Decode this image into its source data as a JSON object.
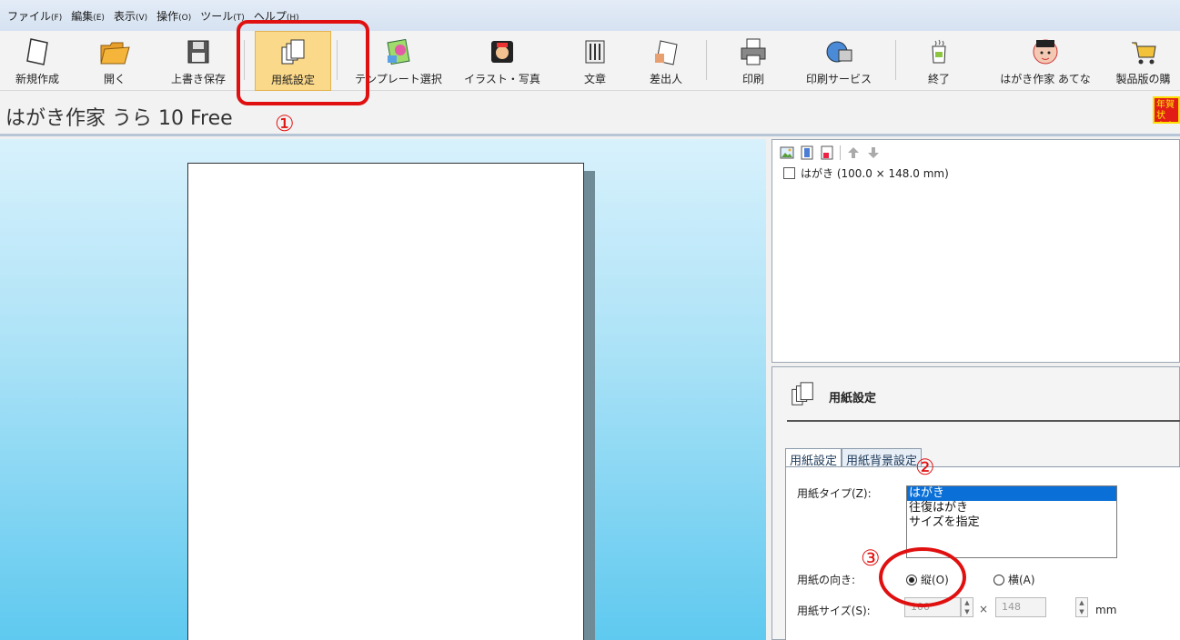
{
  "menu": [
    {
      "label": "ファイル",
      "acc": "(F)"
    },
    {
      "label": "編集",
      "acc": "(E)"
    },
    {
      "label": "表示",
      "acc": "(V)"
    },
    {
      "label": "操作",
      "acc": "(O)"
    },
    {
      "label": "ツール",
      "acc": "(T)"
    },
    {
      "label": "ヘルプ",
      "acc": "(H)"
    }
  ],
  "toolbar": {
    "new": "新規作成",
    "open": "開く",
    "save": "上書き保存",
    "paper": "用紙設定",
    "template": "テンプレート選択",
    "illust": "イラスト・写真",
    "text": "文章",
    "sender": "差出人",
    "print": "印刷",
    "print_service": "印刷サービス",
    "exit": "終了",
    "atena": "はがき作家 あてな",
    "buy": "製品版の購"
  },
  "app_title": "はがき作家 うら 10 Free",
  "badge": "年賀状 喪中は",
  "paper_list": {
    "item": "はがき (100.0 × 148.0 mm)"
  },
  "panel": {
    "title": "用紙設定",
    "tabs": [
      "用紙設定",
      "用紙背景設定"
    ],
    "paper_type_label": "用紙タイプ(Z):",
    "paper_types": [
      "はがき",
      "往復はがき",
      "サイズを指定"
    ],
    "orientation_label": "用紙の向き:",
    "orientation_portrait": "縦(O)",
    "orientation_landscape": "横(A)",
    "size_label": "用紙サイズ(S):",
    "width": "100",
    "height": "148",
    "times": "×",
    "unit": "mm"
  },
  "annotations": {
    "n1": "①",
    "n2": "②",
    "n3": "③"
  },
  "colors": {
    "annotation": "#e01010",
    "selection": "#0a6fd6",
    "active_tool": "#fbd98a"
  }
}
